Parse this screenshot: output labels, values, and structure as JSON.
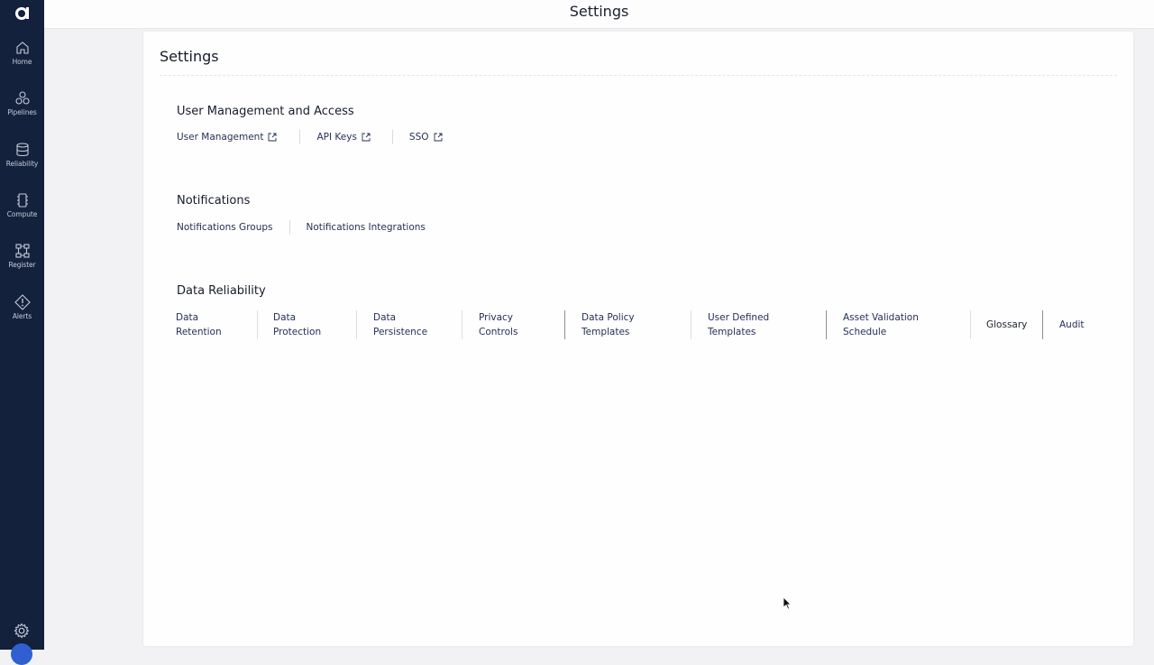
{
  "app": {
    "logo_letter": "a",
    "page_header": "Settings"
  },
  "sidebar": {
    "items": [
      {
        "label": "Home",
        "icon": "home-icon"
      },
      {
        "label": "Pipelines",
        "icon": "pipelines-icon"
      },
      {
        "label": "Reliability",
        "icon": "reliability-icon"
      },
      {
        "label": "Compute",
        "icon": "compute-icon"
      },
      {
        "label": "Register",
        "icon": "register-icon"
      },
      {
        "label": "Alerts",
        "icon": "alerts-icon"
      }
    ],
    "bottom_icon": "gear-icon"
  },
  "card": {
    "title": "Settings",
    "sections": {
      "user_access": {
        "title": "User Management and Access",
        "links": [
          "User Management",
          "API Keys",
          "SSO"
        ]
      },
      "notifications": {
        "title": "Notifications",
        "links": [
          "Notifications Groups",
          "Notifications Integrations"
        ]
      },
      "data_reliability": {
        "title": "Data Reliability",
        "links": [
          {
            "line1": "Data",
            "line2": "Retention"
          },
          {
            "line1": "Data",
            "line2": "Protection"
          },
          {
            "line1": "Data",
            "line2": "Persistence"
          },
          {
            "line1": "Privacy",
            "line2": "Controls"
          },
          {
            "line1": "Data Policy",
            "line2": "Templates"
          },
          {
            "line1": "User Defined",
            "line2": "Templates"
          },
          {
            "line1": "Asset Validation",
            "line2": "Schedule"
          },
          {
            "line1": "Glossary",
            "line2": ""
          },
          {
            "line1": "Audit",
            "line2": ""
          }
        ]
      }
    }
  },
  "colors": {
    "sidebar_bg": "#14213d",
    "link_text": "#253157",
    "accent": "#2f5fd0"
  }
}
